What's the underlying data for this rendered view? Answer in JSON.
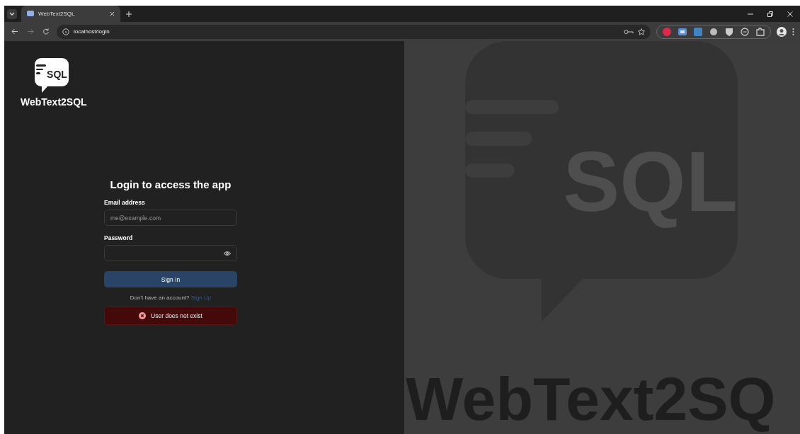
{
  "browser": {
    "tab": {
      "title": "WebText2SQL",
      "selected": true
    },
    "address": "localhost/login"
  },
  "brand": {
    "logo_text": "SQL",
    "name": "WebText2SQL"
  },
  "form": {
    "heading": "Login to access the app",
    "fields": [
      {
        "label": "Email address",
        "placeholder": "me@example.com",
        "kind": "text"
      },
      {
        "label": "Password",
        "kind": "password"
      }
    ],
    "submit": "Sign In",
    "signup_prompt": "Don't have an account?",
    "signup_link": "Sign Up",
    "error": "User does not exist"
  },
  "backdrop": {
    "logo_text": "SQL",
    "name": "WebText2SQ"
  }
}
